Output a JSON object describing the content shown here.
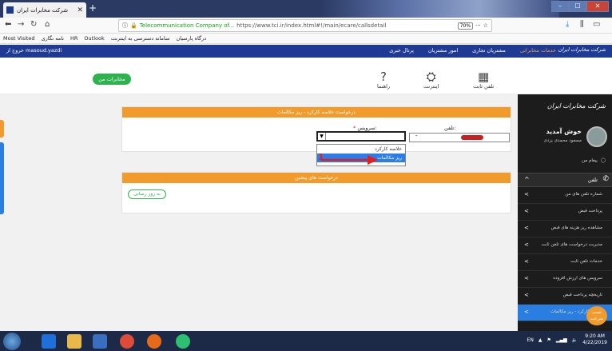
{
  "browser": {
    "tab_title": "شرکت مخابرات ایران",
    "url_site": "Telecommunication Company of...",
    "url_path": "https://www.tci.ir/index.html#!/main/ecare/callsdetail",
    "zoom": "70%"
  },
  "bookmarks": [
    "Most Visited",
    "نامه نگاری",
    "HR",
    "Outlook",
    "سامانه دسترسی به اینترنت",
    "درگاه پارسیان"
  ],
  "site_header": {
    "logout": "خروج از masoud.yazdi",
    "menu": [
      "خدمات مخابراتی",
      "مشتریان تجاری",
      "امور مشتریان",
      "پرتال خبری"
    ],
    "brand": "شرکت مخابرات ایران"
  },
  "subheader": {
    "my_telecom": "مخابرات من",
    "fixed_phone": "تلفن ثابت",
    "internet": "اینترنت",
    "help": "راهنما"
  },
  "form": {
    "panel_title": "درخواست خلاصه کارکرد - ریز مکالمات",
    "phone_label": "تلفن:",
    "service_label": "سرویس:",
    "required_mark": "*",
    "phone_dash": "-",
    "options": [
      "خلاصه کارکرد",
      "ریز مکالمات"
    ],
    "selected_option": "ریز مکالمات",
    "annotation_number": "1"
  },
  "previous": {
    "panel_title": "درخواست های پیشین",
    "update_button": "به روز رسانی"
  },
  "sidebar": {
    "logo": "شرکت مخابرات ایران",
    "welcome": "خوش آمدید",
    "username": "مسعود محمدی یزدی",
    "messages": "پیغام من",
    "phone_section": "تلفن",
    "items": [
      "شماره تلفن های من",
      "پرداخت قبض",
      "مشاهده ریز هزینه های قبض",
      "مدیریت درخواست های تلفن ثابت",
      "خدمات تلفن ثابت",
      "سرویس های ارزش افزوده",
      "تاریخچه پرداخت قبض",
      "خلاصه کارکرد - ریز مکالمات"
    ],
    "float_button": "تست سرعت"
  },
  "taskbar": {
    "lang": "EN",
    "time": "9:20 AM",
    "date": "4/22/2019"
  }
}
